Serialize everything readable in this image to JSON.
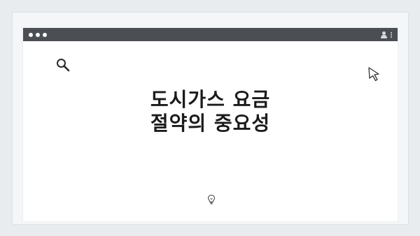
{
  "window": {
    "title": "",
    "headline_line1": "도시가스 요금",
    "headline_line2": "절약의 중요성"
  },
  "icons": {
    "top_indicator": "pagination-dots-icon",
    "traffic_lights": "window-controls-icon",
    "profile": "user-icon",
    "menu": "kebab-menu-icon",
    "search": "search-icon",
    "pointer": "cursor-icon",
    "idea": "lightbulb-icon"
  },
  "colors": {
    "titlebar": "#4b4f54",
    "background": "#e9ecef",
    "text": "#1b1b1b"
  }
}
